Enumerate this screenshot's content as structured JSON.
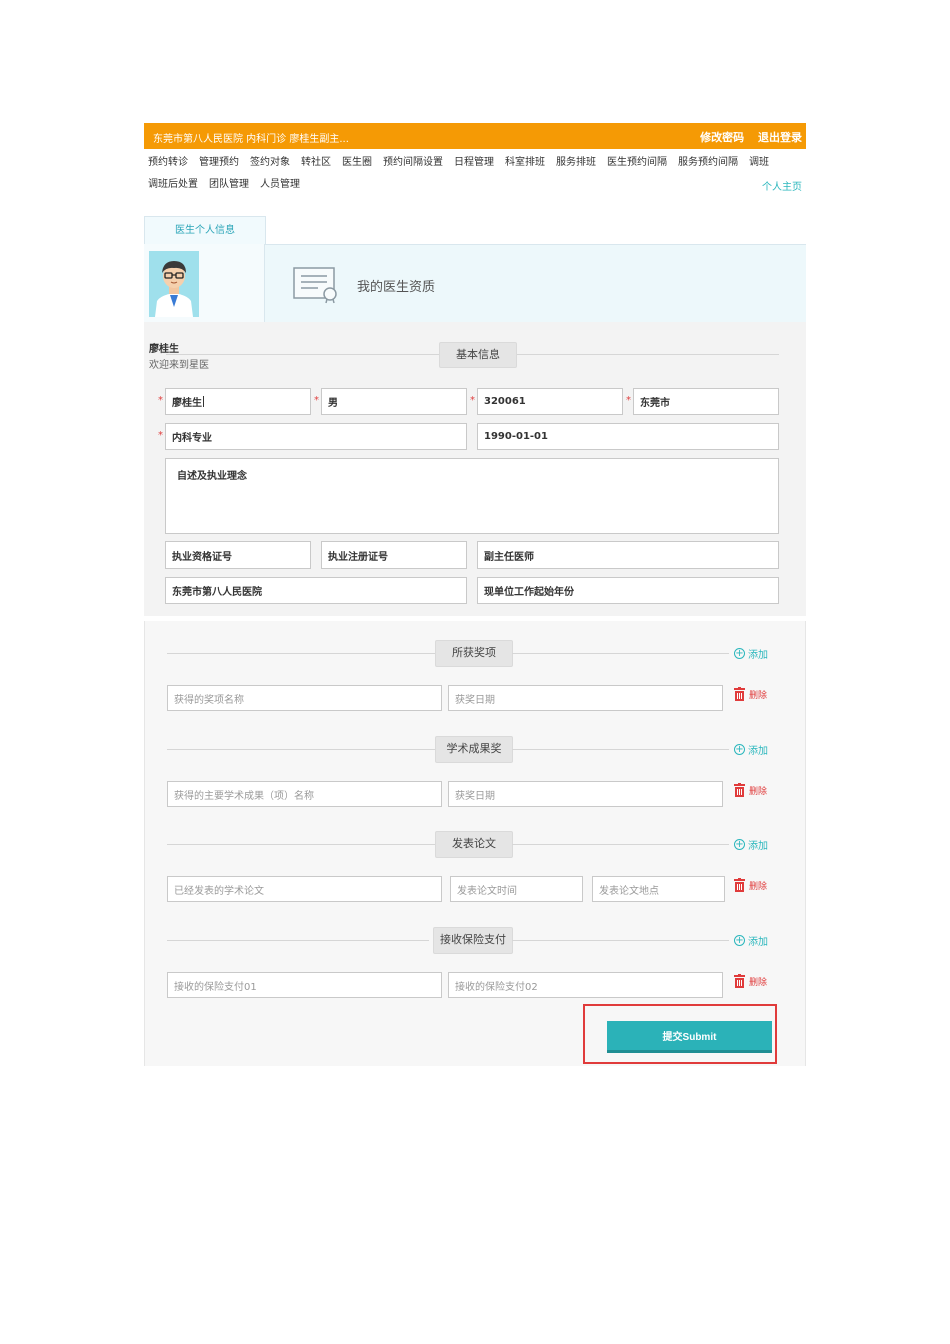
{
  "header": {
    "info": "东莞市第八人民医院 内科门诊 廖桂生副主...",
    "change_password": "修改密码",
    "logout": "退出登录"
  },
  "nav": {
    "row1": [
      "预约转诊",
      "管理预约",
      "签约对象",
      "转社区",
      "医生圈",
      "预约间隔设置",
      "日程管理",
      "科室排班",
      "服务排班",
      "医生预约间隔",
      "服务预约间隔",
      "调班"
    ],
    "row2": [
      "调班后处置",
      "团队管理",
      "人员管理"
    ],
    "personal_home": "个人主页"
  },
  "tab": {
    "label": "医生个人信息"
  },
  "profile": {
    "qualification": "我的医生资质",
    "name": "廖桂生",
    "welcome": "欢迎来到星医"
  },
  "basic": {
    "section": "基本信息",
    "name_value": "廖桂生",
    "gender_value": "男",
    "code_value": "320061",
    "city_value": "东莞市",
    "major_value": "内科专业",
    "birth_value": "1990-01-01",
    "intro_placeholder": "自述及执业理念",
    "cert_no": "执业资格证号",
    "reg_no": "执业注册证号",
    "title_value": "副主任医师",
    "hospital_value": "东莞市第八人民医院",
    "start_year": "现单位工作起始年份"
  },
  "sections": {
    "awards": {
      "title": "所获奖项",
      "field1": "获得的奖项名称",
      "field2": "获奖日期"
    },
    "academic": {
      "title": "学术成果奖",
      "field1": "获得的主要学术成果（项）名称",
      "field2": "获奖日期"
    },
    "papers": {
      "title": "发表论文",
      "field1": "已经发表的学术论文",
      "field2": "发表论文时间",
      "field3": "发表论文地点"
    },
    "insurance": {
      "title": "接收保险支付",
      "field1": "接收的保险支付01",
      "field2": "接收的保险支付02"
    },
    "add_label": "添加",
    "delete_label": "删除"
  },
  "submit_label": "提交Submit",
  "colors": {
    "accent": "#f59a05",
    "teal": "#2bb2b8",
    "danger": "#e03b3b"
  }
}
